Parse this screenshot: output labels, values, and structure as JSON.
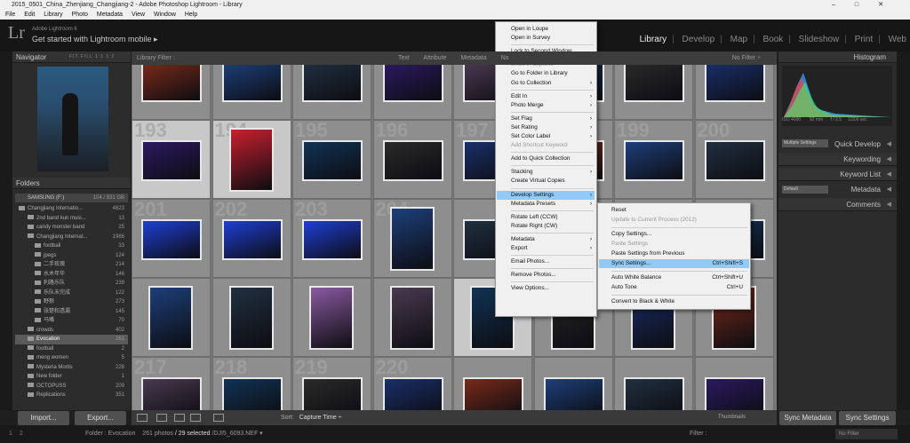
{
  "window": {
    "title": "2015_0501_China_Zhenjiang_Changjiang-2 - Adobe Photoshop Lightroom - Library"
  },
  "menu": [
    "File",
    "Edit",
    "Library",
    "Photo",
    "Metadata",
    "View",
    "Window",
    "Help"
  ],
  "identity": {
    "small": "Adobe Lightroom 6",
    "main": "Get started with Lightroom mobile  ▸",
    "logo": "Lr"
  },
  "modules": [
    "Library",
    "Develop",
    "Map",
    "Book",
    "Slideshow",
    "Print",
    "Web"
  ],
  "navigator": {
    "title": "Navigator",
    "zoom": "FIT  FILL  1:1  1:2"
  },
  "folders": {
    "title": "Folders",
    "volume": {
      "name": "SAMSUNG (F:)",
      "size": "104 / 931 GB"
    },
    "items": [
      {
        "label": "Changjiang Internatio...",
        "count": "4823"
      },
      {
        "label": "2nd band kun musi...",
        "count": "13"
      },
      {
        "label": "candy monster band",
        "count": "25"
      },
      {
        "label": "Changjiang Internat...",
        "count": "1966"
      },
      {
        "label": "football",
        "count": "33"
      },
      {
        "label": "jpegs",
        "count": "124"
      },
      {
        "label": "二手玫瑰",
        "count": "214"
      },
      {
        "label": "水木年华",
        "count": "146"
      },
      {
        "label": "利路乐队",
        "count": "239"
      },
      {
        "label": "乐队未完成",
        "count": "122"
      },
      {
        "label": "野狼",
        "count": "273"
      },
      {
        "label": "张楚和透漏",
        "count": "145"
      },
      {
        "label": "马嘴",
        "count": "70"
      },
      {
        "label": "crowds",
        "count": "402"
      },
      {
        "label": "Evocation",
        "count": "261"
      },
      {
        "label": "football",
        "count": "2"
      },
      {
        "label": "meng women",
        "count": "5"
      },
      {
        "label": "Mysteria Mortis",
        "count": "228"
      },
      {
        "label": "New folder",
        "count": "1"
      },
      {
        "label": "OCTOPUSS",
        "count": "209"
      },
      {
        "label": "Replications",
        "count": "351"
      }
    ]
  },
  "left_buttons": {
    "import": "Import...",
    "export": "Export..."
  },
  "filterbar": {
    "title": "Library Filter :",
    "items": [
      "Text",
      "Attribute",
      "Metadata",
      "No"
    ],
    "nofilter": "No Filter ÷"
  },
  "grid_numbers": {
    "row2": [
      "193",
      "194",
      "195",
      "196",
      "197",
      "198",
      "199",
      "200"
    ],
    "row3": [
      "201",
      "202",
      "203",
      "204"
    ],
    "row5": [
      "217",
      "218",
      "219",
      "220"
    ]
  },
  "toolbar": {
    "sort_label": "Sort:",
    "sort_value": "Capture Time ÷",
    "thumbs": "Thumbnails"
  },
  "filmstrip": {
    "nums": "1 2",
    "folder": "Folder : Evocation",
    "photos": "261 photos",
    "selected": "/ 29 selected",
    "file": "/DJI5_6093.NEF ▾",
    "filter": "Filter :",
    "nofilter": "No Filter"
  },
  "histogram": {
    "title": "Histogram",
    "stats": [
      "ISO 4000",
      "92 mm",
      "f / 2.5",
      "1/200 sec"
    ]
  },
  "right_panels": {
    "quick_develop": "Quick Develop",
    "keywording": "Keywording",
    "keyword_list": "Keyword List",
    "metadata": "Metadata",
    "comments": "Comments",
    "multiple_settings": "Multiple Settings",
    "default": "Default"
  },
  "right_buttons": {
    "sync_metadata": "Sync Metadata",
    "sync_settings": "Sync Settings"
  },
  "context_menu": [
    {
      "label": "Open in Loupe"
    },
    {
      "label": "Open in Survey"
    },
    {
      "sep": true
    },
    {
      "label": "Lock to Second Window"
    },
    {
      "sep": true
    },
    {
      "label": "Show in Explorer",
      "dis": true
    },
    {
      "label": "Go to Folder in Library"
    },
    {
      "label": "Go to Collection",
      "arrow": true
    },
    {
      "sep": true
    },
    {
      "label": "Edit In",
      "arrow": true
    },
    {
      "label": "Photo Merge",
      "arrow": true
    },
    {
      "sep": true
    },
    {
      "label": "Set Flag",
      "arrow": true
    },
    {
      "label": "Set Rating",
      "arrow": true
    },
    {
      "label": "Set Color Label",
      "arrow": true
    },
    {
      "label": "Add Shortcut Keyword",
      "dis": true
    },
    {
      "sep": true
    },
    {
      "label": "Add to Quick Collection"
    },
    {
      "sep": true
    },
    {
      "label": "Stacking",
      "arrow": true
    },
    {
      "label": "Create Virtual Copies"
    },
    {
      "sep": true
    },
    {
      "label": "Develop Settings",
      "arrow": true,
      "hi": true
    },
    {
      "label": "Metadata Presets",
      "arrow": true
    },
    {
      "sep": true
    },
    {
      "label": "Rotate Left (CCW)"
    },
    {
      "label": "Rotate Right (CW)"
    },
    {
      "sep": true
    },
    {
      "label": "Metadata",
      "arrow": true
    },
    {
      "label": "Export",
      "arrow": true
    },
    {
      "sep": true
    },
    {
      "label": "Email Photos..."
    },
    {
      "sep": true
    },
    {
      "label": "Remove Photos..."
    },
    {
      "sep": true
    },
    {
      "label": "View Options..."
    }
  ],
  "submenu": [
    {
      "label": "Reset"
    },
    {
      "label": "Update to Current Process (2012)",
      "dis": true
    },
    {
      "sep": true
    },
    {
      "label": "Copy Settings..."
    },
    {
      "label": "Paste Settings",
      "dis": true
    },
    {
      "label": "Paste Settings from Previous"
    },
    {
      "label": "Sync Settings...",
      "shortcut": "Ctrl+Shift+S",
      "hi": true
    },
    {
      "sep": true
    },
    {
      "label": "Auto White Balance",
      "shortcut": "Ctrl+Shift+U"
    },
    {
      "label": "Auto Tone",
      "shortcut": "Ctrl+U"
    },
    {
      "sep": true
    },
    {
      "label": "Convert to Black & White"
    }
  ],
  "colors": {
    "menu_highlight": "#91c9f7",
    "panel": "#2c2c2c",
    "grid": "#777777"
  }
}
